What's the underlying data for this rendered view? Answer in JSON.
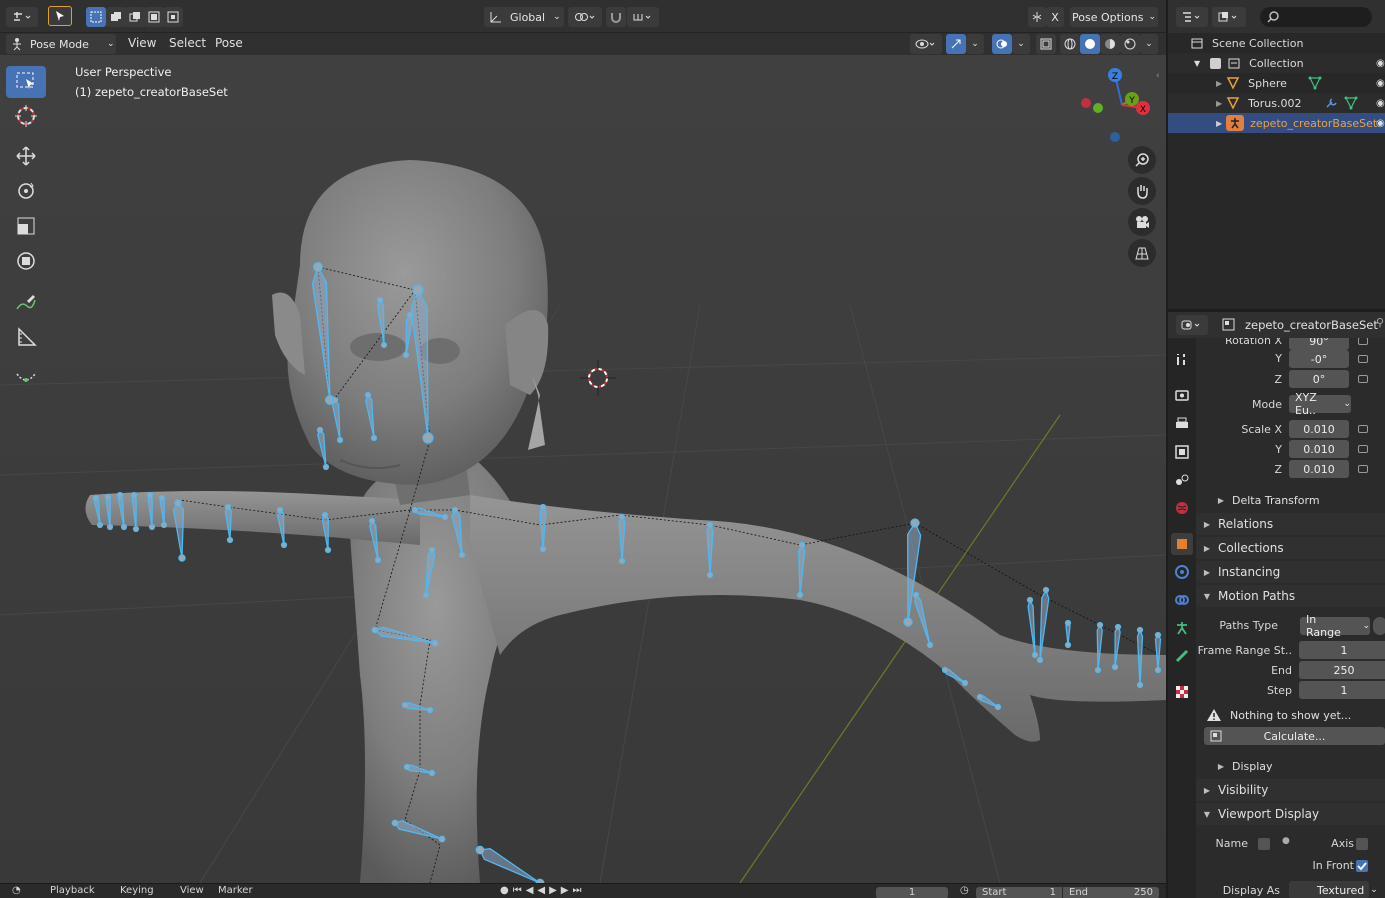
{
  "header": {
    "transform_orientation": "Global",
    "x_toggle": "X",
    "pose_options": "Pose Options"
  },
  "view_header": {
    "mode": "Pose Mode",
    "menus": [
      "View",
      "Select",
      "Pose"
    ]
  },
  "viewport": {
    "perspective_label": "User Perspective",
    "object_label": "(1) zepeto_creatorBaseSet",
    "gizmo_axes": {
      "z": "Z",
      "y": "Y",
      "x": "X"
    }
  },
  "timeline": {
    "items": [
      "Playback",
      "Keying",
      "View",
      "Marker"
    ],
    "current_frame": "1",
    "start_label": "Start",
    "start_value": "1",
    "end_label": "End",
    "end_value": "250"
  },
  "outliner": {
    "rows": [
      {
        "label": "Scene Collection",
        "icon": "scene-collection-icon"
      },
      {
        "label": "Collection",
        "icon": "collection-icon"
      },
      {
        "label": "Sphere",
        "icon": "mesh-icon"
      },
      {
        "label": "Torus.002",
        "icon": "mesh-icon"
      },
      {
        "label": "zepeto_creatorBaseSet",
        "icon": "armature-icon"
      }
    ]
  },
  "properties": {
    "object_name": "zepeto_creatorBaseSet",
    "rotation": {
      "label_x": "Rotation X",
      "x": "90°",
      "label_y": "Y",
      "y": "-0°",
      "label_z": "Z",
      "z": "0°"
    },
    "mode_label": "Mode",
    "mode_value": "XYZ Eu..",
    "scale": {
      "label_x": "Scale X",
      "x": "0.010",
      "label_y": "Y",
      "y": "0.010",
      "label_z": "Z",
      "z": "0.010"
    },
    "sections": {
      "delta_transform": "Delta Transform",
      "relations": "Relations",
      "collections": "Collections",
      "instancing": "Instancing",
      "motion_paths": "Motion Paths",
      "display": "Display",
      "visibility": "Visibility",
      "viewport_display": "Viewport Display"
    },
    "motion_paths": {
      "paths_type_label": "Paths Type",
      "paths_type_value": "In Range",
      "frame_range_label": "Frame Range St..",
      "frame_range_value": "1",
      "end_label": "End",
      "end_value": "250",
      "step_label": "Step",
      "step_value": "1",
      "warning": "Nothing to show yet...",
      "calculate": "Calculate..."
    },
    "viewport_display": {
      "name_label": "Name",
      "axis_label": "Axis",
      "in_front_label": "In Front",
      "display_as_label": "Display As",
      "display_as_value": "Textured"
    }
  },
  "colors": {
    "accent": "#4772b3",
    "bone": "#4fb8f0",
    "selected_text": "#f0a040"
  }
}
